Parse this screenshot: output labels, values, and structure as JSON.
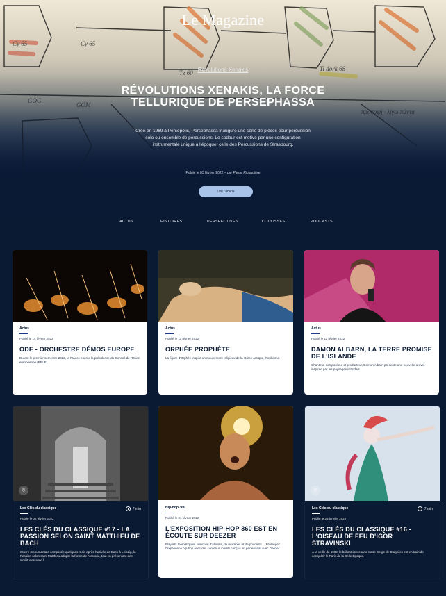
{
  "header": {
    "brand": "Le Magazine",
    "category": "Révolutions Xenakis",
    "title": "RÉVOLUTIONS XENAKIS, LA FORCE TELLURIQUE DE PERSEPHASSA",
    "summary": "Créé en 1969 à Persepolis, Persephassa inaugure une série de pièces pour percussion solo ou ensemble de percussions. Le sodaur est motivé par une configuration instrumentale unique à l'époque, celle des Percussions de Strasbourg.",
    "meta_date": "Publié le 03 février 2022",
    "meta_author": "par Pierre Rigaudière",
    "cta_label": "Lire l'article"
  },
  "nav": {
    "items": [
      "ACTUS",
      "HISTOIRES",
      "PERSPECTIVES",
      "COULISSES",
      "PODCASTS"
    ]
  },
  "cards": [
    {
      "tag": "Actus",
      "date": "Publié le 14 février 2022",
      "title": "ODE - ORCHESTRE DÉMOS EUROPE",
      "excerpt": "Durant le premier semestre 2022, la France exerce la présidence du Conseil de l'Union européenne (PFUE)."
    },
    {
      "tag": "Actus",
      "date": "Publié le 11 février 2022",
      "title": "ORPHÉE PROPHÈTE",
      "excerpt": "La figure d'Orphée inspira un mouvement religieux de la Grèce antique, l'orphisme."
    },
    {
      "tag": "Actus",
      "date": "Publié le 11 février 2022",
      "title": "DAMON ALBARN, LA TERRE PROMISE DE L'ISLANDE",
      "excerpt": "Chanteur, compositeur et producteur, Damon Albarn présente une nouvelle œuvre inspirée par les paysages islandais."
    },
    {
      "tag": "Les Clés du classique",
      "duration": "7 min",
      "date": "Publié le 02 février 2022",
      "title": "LES CLÉS DU CLASSIQUE #17 - LA PASSION SELON SAINT MATTHIEU DE BACH",
      "excerpt": "Œuvre monumentale composée quelques mois après l'arrivée de Bach à Leipzig, la Passion selon saint Matthieu adopte la forme de l'oratorio, tout en présentant des similitudes avec l..."
    },
    {
      "tag": "Hip-hop 360",
      "date": "Publié le 01 février 2022",
      "title": "L'EXPOSITION HIP-HOP 360 EST EN ÉCOUTE SUR DEEZER",
      "excerpt": "Playlists thématiques, sélection d'albums, de mixtapes et de podcasts… Prolongez l'expérience hip-hop avec des contenus inédits conçus en partenariat avec Deezer."
    },
    {
      "tag": "Les Clés du classique",
      "duration": "7 min",
      "date": "Publié le 26 janvier 2022",
      "title": "LES CLÉS DU CLASSIQUE #16 - L'OISEAU DE FEU D'IGOR STRAVINSKI",
      "excerpt": "À la veille de 1909, le brillant impresario russe Serge de Diaghilev est en train de conquérir le Paris de la Belle Époque."
    }
  ],
  "colors": {
    "navy": "#0b1a33",
    "cta": "#a9c3e8",
    "accent_rule": "#1e3a8a"
  },
  "icons": {
    "duration": "clock-icon",
    "location": "location-pin-icon"
  }
}
